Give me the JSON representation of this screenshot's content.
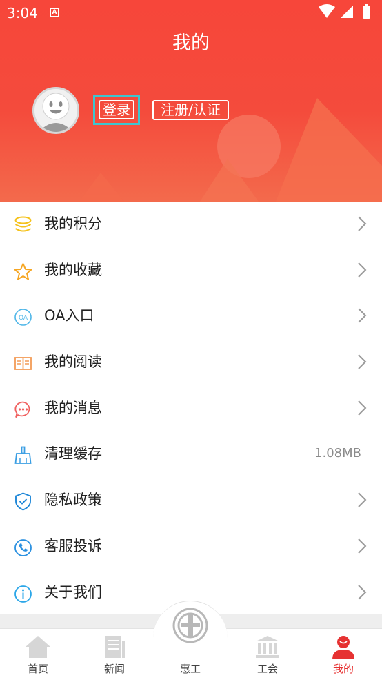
{
  "status_bar": {
    "time": "3:04",
    "notification_icon": "a-badge-icon",
    "icons": [
      "wifi-icon",
      "signal-icon",
      "battery-icon"
    ]
  },
  "header": {
    "title": "我的",
    "login_label": "登录",
    "register_label": "注册/认证"
  },
  "menu": [
    {
      "label": "我的积分",
      "icon": "coins-icon",
      "color": "#f5c21b"
    },
    {
      "label": "我的收藏",
      "icon": "star-icon",
      "color": "#f6a623"
    },
    {
      "label": "OA入口",
      "icon": "oa-icon",
      "color": "#4fb6e8"
    },
    {
      "label": "我的阅读",
      "icon": "book-icon",
      "color": "#f39b55"
    },
    {
      "label": "我的消息",
      "icon": "message-icon",
      "color": "#f0605f"
    },
    {
      "label": "清理缓存",
      "icon": "broom-icon",
      "color": "#3a9ee3",
      "value": "1.08MB"
    },
    {
      "label": "隐私政策",
      "icon": "shield-icon",
      "color": "#1e87d8"
    },
    {
      "label": "客服投诉",
      "icon": "phone-icon",
      "color": "#2a90e0"
    },
    {
      "label": "关于我们",
      "icon": "info-icon",
      "color": "#2aa6e8"
    }
  ],
  "tabs": [
    {
      "label": "首页",
      "icon": "home-icon"
    },
    {
      "label": "新闻",
      "icon": "news-icon"
    },
    {
      "label": "惠工",
      "icon": "union-logo-icon"
    },
    {
      "label": "工会",
      "icon": "building-icon"
    },
    {
      "label": "我的",
      "icon": "user-icon",
      "active": true
    }
  ],
  "colors": {
    "header_top": "#f7463a",
    "accent": "#e63232",
    "highlight_border": "#3fc5cf"
  }
}
